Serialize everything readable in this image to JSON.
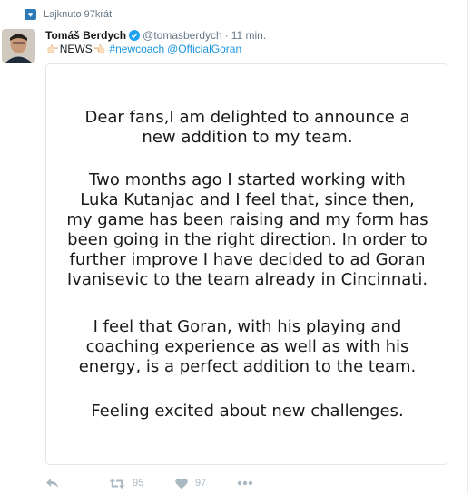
{
  "liked_by": {
    "icon": "heart-badge-icon",
    "text": "Lajknuto 97krát"
  },
  "tweet": {
    "name": "Tomáš Berdych",
    "handle": "@tomasberdych",
    "separator": "·",
    "time": "11 min.",
    "text_prefix_emoji": "👉🏻",
    "text_word": "NEWS",
    "text_suffix_emoji": "👈🏻",
    "hashtag": "#newcoach",
    "mention": "@OfficialGoran",
    "image_paragraphs": [
      "Dear fans,I am delighted to announce a\nnew addition to my team.",
      "Two months ago I started working with\nLuka Kutanjac and I feel that, since then,\nmy game has been raising and my form has\nbeen going in the right direction. In order to\nfurther improve I have decided to ad Goran\nIvanisevic to the team already in Cincinnati.",
      "I feel that Goran, with his playing and\ncoaching experience as well as with his\nenergy, is a perfect addition to the  team.",
      "Feeling excited about new challenges."
    ]
  },
  "actions": {
    "reply_icon": "reply-icon",
    "retweet_icon": "retweet-icon",
    "retweet_count": "95",
    "like_icon": "heart-icon",
    "like_count": "97",
    "more_icon": "more-dots-icon"
  },
  "colors": {
    "link": "#1b95e0",
    "muted": "#657786",
    "action": "#aab8c2",
    "verified": "#1da1f2"
  }
}
